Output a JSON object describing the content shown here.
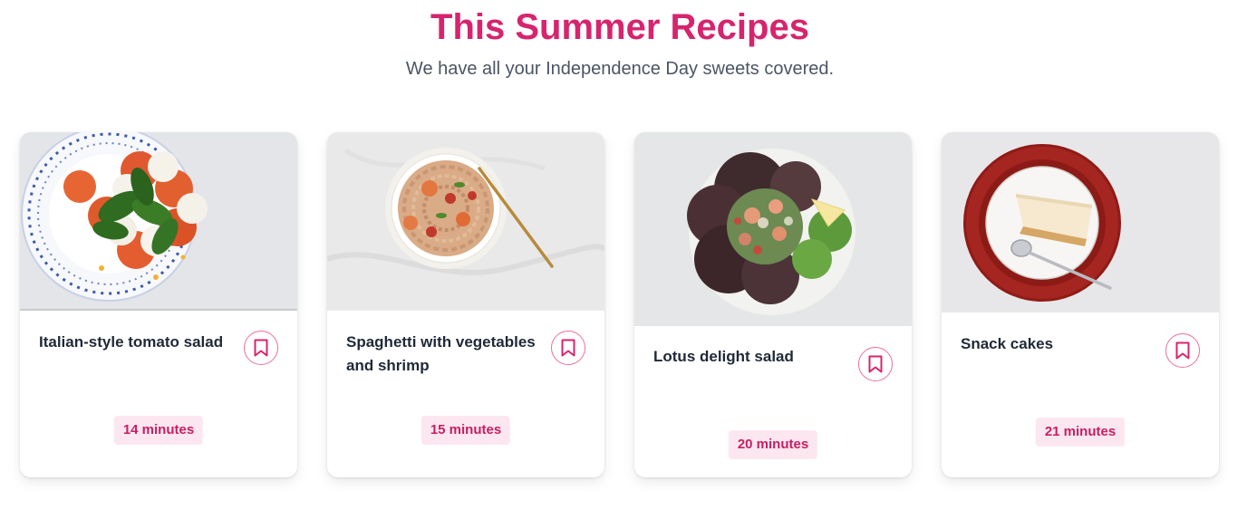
{
  "header": {
    "title": "This Summer Recipes",
    "subtitle": "We have all your Independence Day sweets covered."
  },
  "recipes": [
    {
      "title": "Italian-style tomato salad",
      "duration": "14 minutes",
      "image": "tomato-mozzarella-basil-plate",
      "bookmark_icon": "bookmark-icon"
    },
    {
      "title": "Spaghetti with vegetables and shrimp",
      "duration": "15 minutes",
      "image": "shrimp-spaghetti-plate",
      "bookmark_icon": "bookmark-icon"
    },
    {
      "title": "Lotus delight salad",
      "duration": "20 minutes",
      "image": "seafood-lettuce-salad-plate",
      "bookmark_icon": "bookmark-icon"
    },
    {
      "title": "Snack cakes",
      "duration": "21 minutes",
      "image": "cake-slice-red-plate",
      "bookmark_icon": "bookmark-icon"
    }
  ],
  "colors": {
    "accent": "#d6246e",
    "badge_bg": "#fce7f1",
    "bookmark": "#ec6f9f",
    "text": "#1f2937",
    "muted": "#4b5563"
  }
}
